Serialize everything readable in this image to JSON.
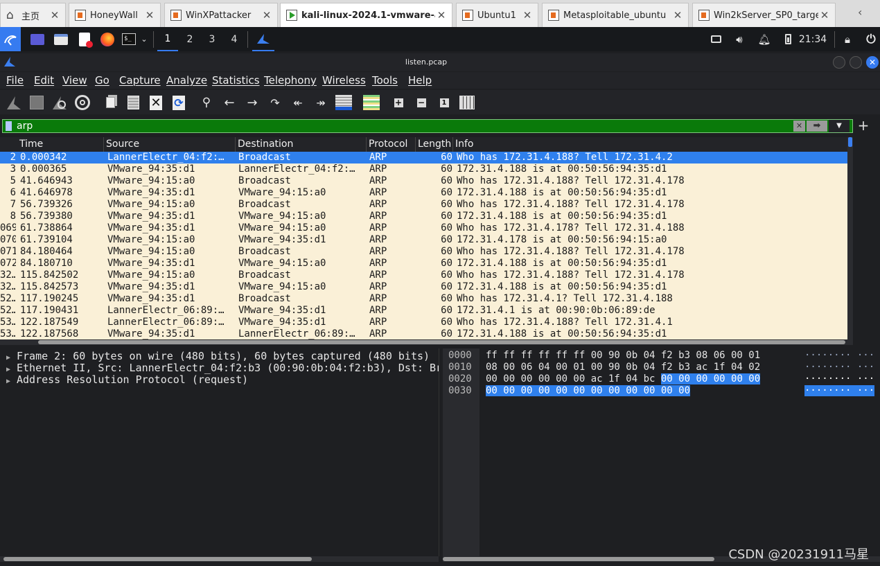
{
  "vm_tabs": [
    {
      "label": "主页",
      "icon": "home-icon",
      "active": false
    },
    {
      "label": "HoneyWall",
      "icon": "vm-icon",
      "active": false
    },
    {
      "label": "WinXPattacker",
      "icon": "vm-icon",
      "active": false
    },
    {
      "label": "kali-linux-2024.1-vmware-a...",
      "icon": "vm-running-icon",
      "active": true
    },
    {
      "label": "Ubuntu1",
      "icon": "vm-icon",
      "active": false
    },
    {
      "label": "Metasploitable_ubuntu",
      "icon": "vm-icon",
      "active": false
    },
    {
      "label": "Win2kServer_SP0_target",
      "icon": "vm-icon",
      "active": false
    }
  ],
  "panel": {
    "workspaces": [
      "1",
      "2",
      "3",
      "4"
    ],
    "active_workspace": "1",
    "clock": "21:34"
  },
  "window": {
    "title": "listen.pcap"
  },
  "menu": [
    "File",
    "Edit",
    "View",
    "Go",
    "Capture",
    "Analyze",
    "Statistics",
    "Telephony",
    "Wireless",
    "Tools",
    "Help"
  ],
  "filter": {
    "value": "arp"
  },
  "packet_list": {
    "columns": [
      "Time",
      "Source",
      "Destination",
      "Protocol",
      "Length",
      "Info"
    ],
    "rows": [
      {
        "no": "2",
        "time": "0.000342",
        "src": "LannerElectr_04:f2:…",
        "dst": "Broadcast",
        "proto": "ARP",
        "len": "60",
        "info": "Who has 172.31.4.188? Tell 172.31.4.2",
        "selected": true
      },
      {
        "no": "3",
        "time": "0.000365",
        "src": "VMware_94:35:d1",
        "dst": "LannerElectr_04:f2:…",
        "proto": "ARP",
        "len": "60",
        "info": "172.31.4.188 is at 00:50:56:94:35:d1"
      },
      {
        "no": "5",
        "time": "41.646943",
        "src": "VMware_94:15:a0",
        "dst": "Broadcast",
        "proto": "ARP",
        "len": "60",
        "info": "Who has 172.31.4.188? Tell 172.31.4.178"
      },
      {
        "no": "6",
        "time": "41.646978",
        "src": "VMware_94:35:d1",
        "dst": "VMware_94:15:a0",
        "proto": "ARP",
        "len": "60",
        "info": "172.31.4.188 is at 00:50:56:94:35:d1"
      },
      {
        "no": "7",
        "time": "56.739326",
        "src": "VMware_94:15:a0",
        "dst": "Broadcast",
        "proto": "ARP",
        "len": "60",
        "info": "Who has 172.31.4.188? Tell 172.31.4.178"
      },
      {
        "no": "8",
        "time": "56.739380",
        "src": "VMware_94:35:d1",
        "dst": "VMware_94:15:a0",
        "proto": "ARP",
        "len": "60",
        "info": "172.31.4.188 is at 00:50:56:94:35:d1"
      },
      {
        "no": "069",
        "time": "61.738864",
        "src": "VMware_94:35:d1",
        "dst": "VMware_94:15:a0",
        "proto": "ARP",
        "len": "60",
        "info": "Who has 172.31.4.178? Tell 172.31.4.188"
      },
      {
        "no": "070",
        "time": "61.739104",
        "src": "VMware_94:15:a0",
        "dst": "VMware_94:35:d1",
        "proto": "ARP",
        "len": "60",
        "info": "172.31.4.178 is at 00:50:56:94:15:a0"
      },
      {
        "no": "071",
        "time": "84.180464",
        "src": "VMware_94:15:a0",
        "dst": "Broadcast",
        "proto": "ARP",
        "len": "60",
        "info": "Who has 172.31.4.188? Tell 172.31.4.178"
      },
      {
        "no": "072",
        "time": "84.180710",
        "src": "VMware_94:35:d1",
        "dst": "VMware_94:15:a0",
        "proto": "ARP",
        "len": "60",
        "info": "172.31.4.188 is at 00:50:56:94:35:d1"
      },
      {
        "no": "32…",
        "time": "115.842502",
        "src": "VMware_94:15:a0",
        "dst": "Broadcast",
        "proto": "ARP",
        "len": "60",
        "info": "Who has 172.31.4.188? Tell 172.31.4.178"
      },
      {
        "no": "32…",
        "time": "115.842573",
        "src": "VMware_94:35:d1",
        "dst": "VMware_94:15:a0",
        "proto": "ARP",
        "len": "60",
        "info": "172.31.4.188 is at 00:50:56:94:35:d1"
      },
      {
        "no": "52…",
        "time": "117.190245",
        "src": "VMware_94:35:d1",
        "dst": "Broadcast",
        "proto": "ARP",
        "len": "60",
        "info": "Who has 172.31.4.1? Tell 172.31.4.188"
      },
      {
        "no": "52…",
        "time": "117.190431",
        "src": "LannerElectr_06:89:…",
        "dst": "VMware_94:35:d1",
        "proto": "ARP",
        "len": "60",
        "info": "172.31.4.1 is at 00:90:0b:06:89:de"
      },
      {
        "no": "53…",
        "time": "122.187549",
        "src": "LannerElectr_06:89:…",
        "dst": "VMware_94:35:d1",
        "proto": "ARP",
        "len": "60",
        "info": "Who has 172.31.4.188? Tell 172.31.4.1"
      },
      {
        "no": "53…",
        "time": "122.187568",
        "src": "VMware_94:35:d1",
        "dst": "LannerElectr_06:89:…",
        "proto": "ARP",
        "len": "60",
        "info": "172.31.4.188 is at 00:50:56:94:35:d1"
      }
    ]
  },
  "details": [
    "Frame 2: 60 bytes on wire (480 bits), 60 bytes captured (480 bits)",
    "Ethernet II, Src: LannerElectr_04:f2:b3 (00:90:0b:04:f2:b3), Dst: Br",
    "Address Resolution Protocol (request)"
  ],
  "bytes": [
    {
      "offset": "0000",
      "hex": "ff ff ff ff ff ff 00 90  0b 04 f2 b3 08 06 00 01",
      "hl": "",
      "ascii": "········ ···"
    },
    {
      "offset": "0010",
      "hex": "08 00 06 04 00 01 00 90  0b 04 f2 b3 ac 1f 04 02",
      "hl": "",
      "ascii": "········ ···"
    },
    {
      "offset": "0020",
      "hex": "00 00 00 00 00 00 ac 1f  04 bc ",
      "hl": "00 00 00 00 00 00",
      "ascii": "········ ···"
    },
    {
      "offset": "0030",
      "hex": "",
      "hl": "00 00 00 00 00 00 00 00  00 00 00 00",
      "ascii": "········ ···"
    }
  ],
  "watermark": "CSDN @20231911马星"
}
